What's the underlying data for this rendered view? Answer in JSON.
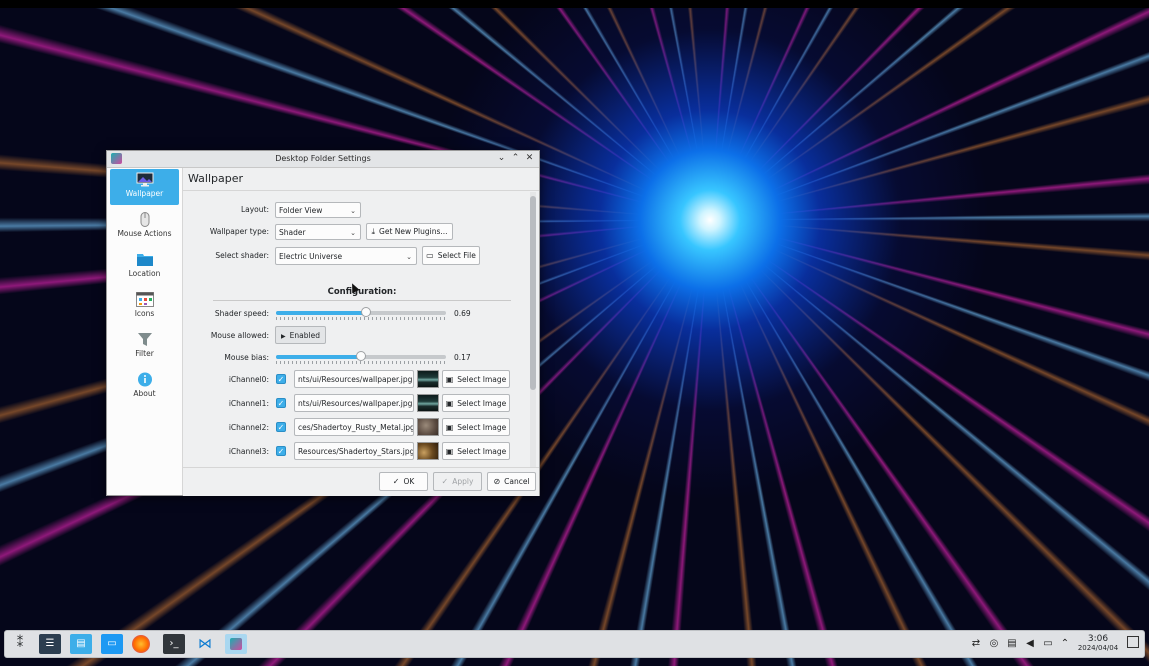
{
  "window": {
    "title": "Desktop Folder Settings",
    "controls": {
      "minimize": "⌄",
      "maximize": "⌃",
      "close": "✕"
    }
  },
  "sidebar": {
    "items": [
      {
        "label": "Wallpaper",
        "icon": "wallpaper-icon",
        "active": true
      },
      {
        "label": "Mouse Actions",
        "icon": "mouse-icon",
        "active": false
      },
      {
        "label": "Location",
        "icon": "folder-icon",
        "active": false
      },
      {
        "label": "Icons",
        "icon": "icons-grid-icon",
        "active": false
      },
      {
        "label": "Filter",
        "icon": "filter-icon",
        "active": false
      },
      {
        "label": "About",
        "icon": "info-icon",
        "active": false
      }
    ]
  },
  "page": {
    "title": "Wallpaper",
    "layout_label": "Layout:",
    "layout_value": "Folder View",
    "wallpaper_type_label": "Wallpaper type:",
    "wallpaper_type_value": "Shader",
    "get_plugins_label": "Get New Plugins...",
    "select_shader_label": "Select shader:",
    "select_shader_value": "Electric Universe",
    "select_file_label": "Select File",
    "configuration_heading": "Configuration:",
    "shader_speed_label": "Shader speed:",
    "shader_speed_value": "0.69",
    "shader_speed_level": 0.53,
    "mouse_allowed_label": "Mouse allowed:",
    "mouse_allowed_value": "Enabled",
    "mouse_bias_label": "Mouse bias:",
    "mouse_bias_value": "0.17",
    "mouse_bias_level": 0.5,
    "channels": [
      {
        "label": "iChannel0:",
        "checked": true,
        "path": "nts/ui/Resources/wallpaper.jpg",
        "thumb": "dark-green-waves",
        "button": "Select Image"
      },
      {
        "label": "iChannel1:",
        "checked": true,
        "path": "nts/ui/Resources/wallpaper.jpg",
        "thumb": "dark-green-waves",
        "button": "Select Image"
      },
      {
        "label": "iChannel2:",
        "checked": true,
        "path": "ces/Shadertoy_Rusty_Metal.jpg",
        "thumb": "rusty-metal",
        "button": "Select Image"
      },
      {
        "label": "iChannel3:",
        "checked": true,
        "path": "Resources/Shadertoy_Stars.jpg",
        "thumb": "stars",
        "button": "Select Image"
      }
    ]
  },
  "footer": {
    "ok": "OK",
    "apply": "Apply",
    "cancel": "Cancel"
  },
  "taskbar": {
    "apps": [
      "app-launcher-icon",
      "system-settings-icon",
      "discover-store-icon",
      "file-manager-icon",
      "firefox-icon",
      "terminal-icon",
      "vscode-icon",
      "shader-wallpaper-app-icon"
    ],
    "tray": [
      "network-icon",
      "screenshot-icon",
      "clipboard-icon",
      "volume-icon",
      "display-icon",
      "tray-expand-icon"
    ],
    "time": "3:06",
    "date": "2024/04/04"
  },
  "colors": {
    "accent": "#3daee9",
    "window_bg": "#eff0f1",
    "sidebar_bg": "#fcfcfc"
  }
}
